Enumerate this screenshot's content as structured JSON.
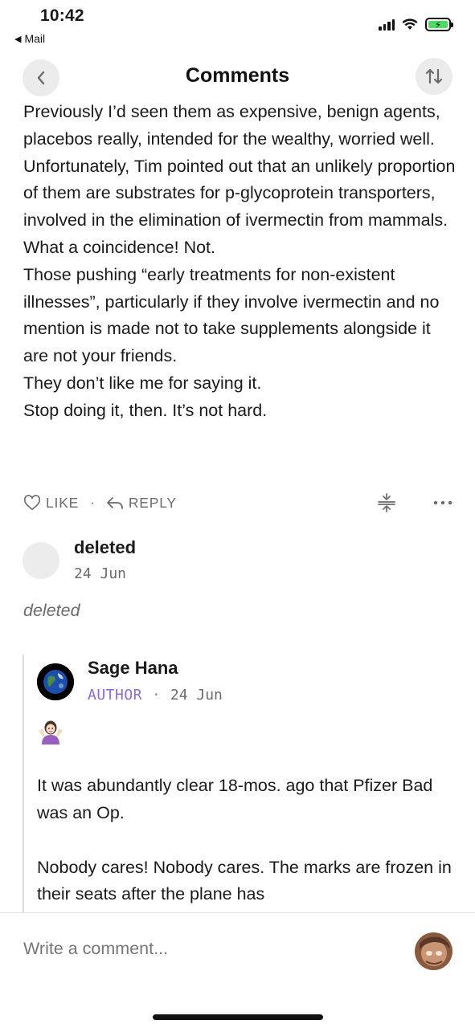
{
  "status_bar": {
    "time": "10:42",
    "back_app": "Mail",
    "battery_color": "#4cd964"
  },
  "header": {
    "title": "Comments",
    "back_icon": "chevron-left-icon",
    "sort_icon": "sort-arrows-icon"
  },
  "comment": {
    "paragraphs": [
      "Previously I’d seen them as expensive, benign agents, placebos really, intended for the wealthy, worried well.",
      "Unfortunately, Tim pointed out that an unlikely proportion of them are substrates for p-glycoprotein transporters, involved in the elimination of ivermectin from mammals. What a coincidence! Not.",
      "Those pushing “early treatments for non-existent illnesses”, particularly if they involve ivermectin and no mention is made not to take supplements alongside it are not your friends.",
      "They don’t like me for saying it.",
      "Stop doing it, then. It’s not hard."
    ],
    "actions": {
      "like": "LIKE",
      "separator": "·",
      "reply": "REPLY"
    }
  },
  "deleted_comment": {
    "name": "deleted",
    "date": "24 Jun",
    "text": "deleted"
  },
  "reply": {
    "name": "Sage Hana",
    "badge": "AUTHOR",
    "separator": "·",
    "date": "24 Jun",
    "badge_color": "#8a6be0",
    "emoji": "woman-shrugging-emoji",
    "paragraphs": [
      "It was abundantly clear 18-mos. ago that Pfizer Bad was an Op.",
      "Nobody cares! Nobody cares. The marks are frozen in their seats after the plane has"
    ]
  },
  "composer": {
    "placeholder": "Write a comment..."
  }
}
